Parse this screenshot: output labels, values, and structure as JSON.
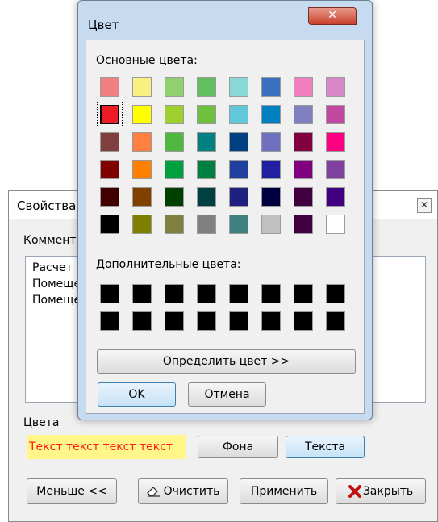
{
  "properties_window": {
    "title": "Свойства",
    "close_glyph": "✕",
    "comments_label": "Комментарий",
    "comment_lines": [
      "Расчет",
      "Помеще",
      "Помеще"
    ],
    "colors_label": "Цвета",
    "preview_text": "Текст текст текст текст",
    "preview_bg": "#fff68a",
    "preview_fg": "#ff1a1a",
    "background_button": "Фона",
    "text_button": "Текста",
    "less_button": "Меньше <<",
    "clear_button": "Очистить",
    "apply_button": "Применить",
    "close_button": "Закрыть",
    "clear_icon": "eraser-icon",
    "close_icon": "red-x-icon"
  },
  "color_dialog": {
    "title": "Цвет",
    "close_glyph": "✕",
    "basic_colors_label": "Основные цвета:",
    "basic_colors": [
      [
        "#f08080",
        "#f8f080",
        "#90d070",
        "#60c060",
        "#88d8d8",
        "#3a70c0",
        "#f080c0",
        "#d888c8"
      ],
      [
        "#ed1c24",
        "#ffff00",
        "#a0d030",
        "#70c040",
        "#60c8d8",
        "#0080c0",
        "#8080c0",
        "#c048a0"
      ],
      [
        "#804040",
        "#ff8040",
        "#50b840",
        "#008080",
        "#004080",
        "#7070c0",
        "#800040",
        "#ff0080"
      ],
      [
        "#800000",
        "#ff8000",
        "#00a040",
        "#008040",
        "#2040a0",
        "#2020a0",
        "#800080",
        "#8040a0"
      ],
      [
        "#400000",
        "#804000",
        "#004000",
        "#004040",
        "#202080",
        "#000040",
        "#400040",
        "#400080"
      ],
      [
        "#000000",
        "#808000",
        "#808040",
        "#808080",
        "#408080",
        "#c0c0c0",
        "#400040",
        "#ffffff"
      ]
    ],
    "selected_color": "#ed1c24",
    "custom_colors_label": "Дополнительные цвета:",
    "custom_colors": [
      [
        "#000000",
        "#000000",
        "#000000",
        "#000000",
        "#000000",
        "#000000",
        "#000000",
        "#000000"
      ],
      [
        "#000000",
        "#000000",
        "#000000",
        "#000000",
        "#000000",
        "#000000",
        "#000000",
        "#000000"
      ]
    ],
    "define_button": "Определить цвет >>",
    "ok_button": "OK",
    "cancel_button": "Отмена"
  }
}
